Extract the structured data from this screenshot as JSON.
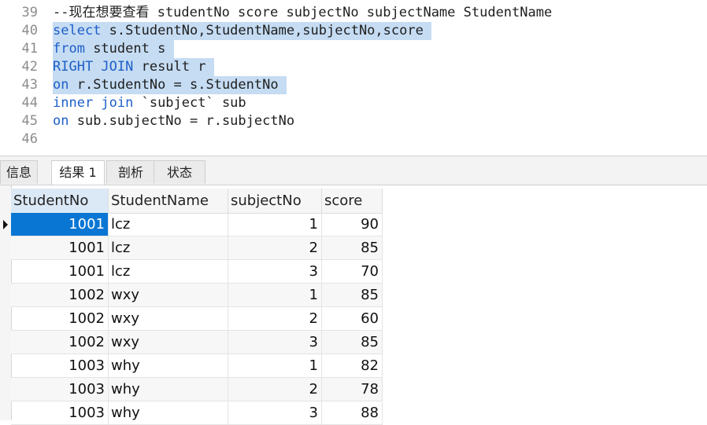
{
  "editor": {
    "lines": [
      {
        "no": "39",
        "parts": [
          {
            "t": "--现在想要查看 studentNo score subjectNo subjectName StudentName",
            "c": "cm"
          }
        ],
        "selected": false
      },
      {
        "no": "40",
        "parts": [
          {
            "t": "select",
            "c": "kw"
          },
          {
            "t": " s.StudentNo,StudentName,subjectNo,score",
            "c": "tx"
          }
        ],
        "selected": true
      },
      {
        "no": "41",
        "parts": [
          {
            "t": "from",
            "c": "kw"
          },
          {
            "t": " student s",
            "c": "tx"
          }
        ],
        "selected": true
      },
      {
        "no": "42",
        "parts": [
          {
            "t": "RIGHT JOIN",
            "c": "kw"
          },
          {
            "t": " result r",
            "c": "tx"
          }
        ],
        "selected": true
      },
      {
        "no": "43",
        "parts": [
          {
            "t": "on",
            "c": "kw"
          },
          {
            "t": " r.StudentNo = s.StudentNo",
            "c": "tx"
          }
        ],
        "selected": true
      },
      {
        "no": "44",
        "parts": [
          {
            "t": "inner join",
            "c": "kw"
          },
          {
            "t": " `subject` sub",
            "c": "tx"
          }
        ],
        "selected": false
      },
      {
        "no": "45",
        "parts": [
          {
            "t": "on",
            "c": "kw"
          },
          {
            "t": " sub.subjectNo = r.subjectNo",
            "c": "tx"
          }
        ],
        "selected": false
      },
      {
        "no": "46",
        "parts": [],
        "selected": false
      }
    ]
  },
  "tabs": [
    {
      "label": "信息",
      "active": false
    },
    {
      "label": "结果 1",
      "active": true
    },
    {
      "label": "剖析",
      "active": false
    },
    {
      "label": "状态",
      "active": false
    }
  ],
  "results": {
    "columns": [
      "StudentNo",
      "StudentName",
      "subjectNo",
      "score"
    ],
    "rows": [
      [
        "1001",
        "lcz",
        "1",
        "90"
      ],
      [
        "1001",
        "lcz",
        "2",
        "85"
      ],
      [
        "1001",
        "lcz",
        "3",
        "70"
      ],
      [
        "1002",
        "wxy",
        "1",
        "85"
      ],
      [
        "1002",
        "wxy",
        "2",
        "60"
      ],
      [
        "1002",
        "wxy",
        "3",
        "85"
      ],
      [
        "1003",
        "why",
        "1",
        "82"
      ],
      [
        "1003",
        "why",
        "2",
        "78"
      ],
      [
        "1003",
        "why",
        "3",
        "88"
      ]
    ]
  },
  "colors": {
    "keyword": "#1e5fc8",
    "selection": "#c5dcf3",
    "current_cell": "#0a76d4"
  }
}
